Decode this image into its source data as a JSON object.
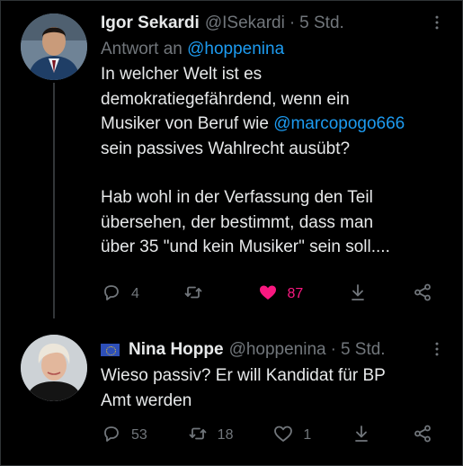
{
  "tweets": [
    {
      "name": "Igor Sekardi",
      "handle": "@ISekardi",
      "time": "5 Std.",
      "reply_prefix": "Antwort an",
      "reply_handle": "@hoppenina",
      "line1": "In welcher Welt ist es",
      "line2": "demokratiegefährdend, wenn ein",
      "line3_pre": "Musiker von Beruf wie ",
      "line3_link": "@marcopogo666",
      "line4": "sein passives Wahlrecht ausübt?",
      "line5": "Hab wohl in der Verfassung den Teil",
      "line6": "übersehen, der bestimmt, dass man",
      "line7": "über 35 \"und kein Musiker\" sein soll....",
      "replies": "4",
      "retweets": "",
      "likes": "87"
    },
    {
      "name": "Nina Hoppe",
      "handle": "@hoppenina",
      "time": "5 Std.",
      "line1": "Wieso passiv? Er will Kandidat für BP",
      "line2": "Amt werden",
      "replies": "53",
      "retweets": "18",
      "likes": "1"
    }
  ],
  "dot": "·",
  "colors": {
    "background": "#000000",
    "text": "#e7e9ea",
    "secondary": "#71767b",
    "link": "#1d9bf0",
    "like": "#f91880"
  },
  "icons": [
    "more-icon",
    "reply-icon",
    "retweet-icon",
    "heart-icon",
    "heart-filled-icon",
    "download-icon",
    "share-icon",
    "eu-flag-icon"
  ]
}
